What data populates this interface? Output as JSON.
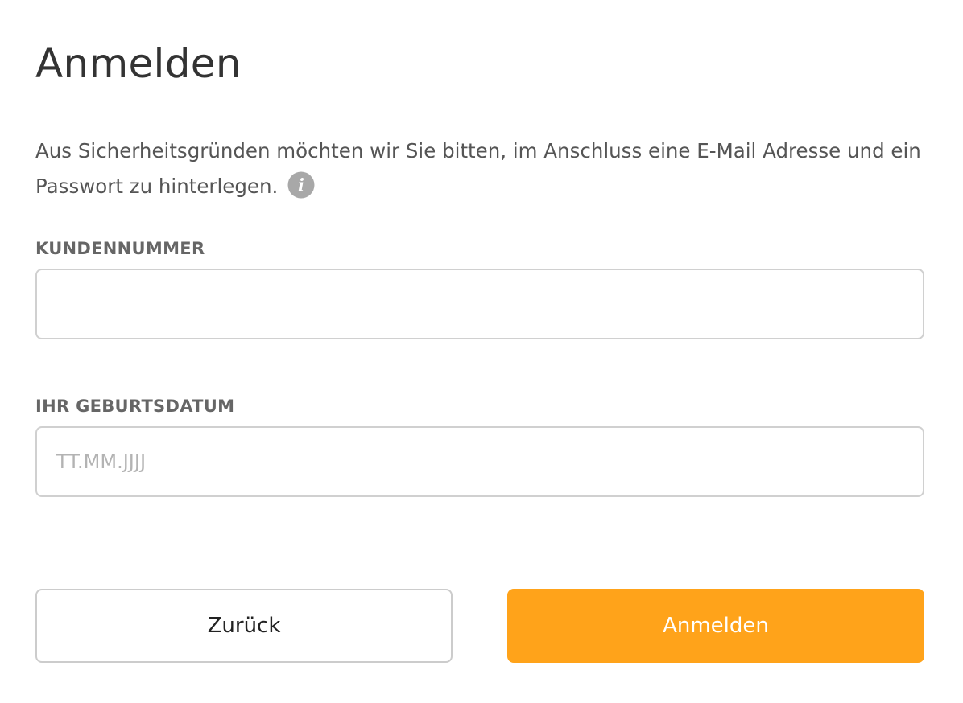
{
  "page": {
    "title": "Anmelden",
    "intro_text": "Aus Sicherheitsgründen möchten wir Sie bitten, im Anschluss eine E-Mail Adresse und ein Passwort zu hinterlegen.",
    "info_icon": "info-icon",
    "info_glyph": "i"
  },
  "form": {
    "customer_number": {
      "label": "KUNDENNUMMER",
      "value": "",
      "placeholder": ""
    },
    "birth_date": {
      "label": "IHR GEBURTSDATUM",
      "value": "",
      "placeholder": "TT.MM.JJJJ"
    }
  },
  "actions": {
    "back_label": "Zurück",
    "submit_label": "Anmelden"
  },
  "colors": {
    "accent": "#ffa31a",
    "title": "#333333",
    "body_text": "#555555",
    "label": "#666666",
    "input_border": "#d0d0d0",
    "placeholder": "#b3b3b3",
    "info_icon": "#a8a8a8"
  }
}
